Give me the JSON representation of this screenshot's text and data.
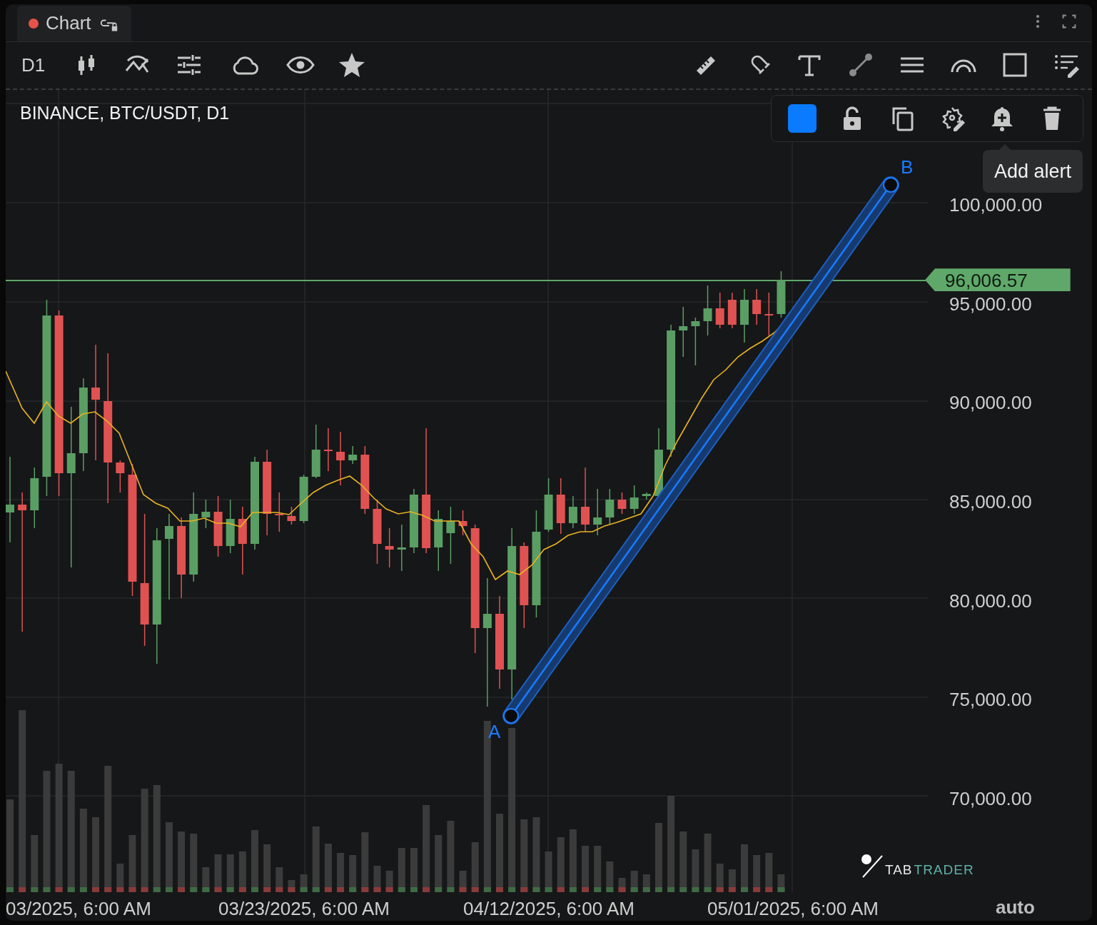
{
  "tabs": [
    {
      "label": "Chart",
      "selected": true
    }
  ],
  "toolbar": {
    "interval": "D1"
  },
  "chart": {
    "legend": "BINANCE, BTC/USDT, D1",
    "y_axis_labels": [
      "100,000.00",
      "95,000.00",
      "90,000.00",
      "85,000.00",
      "80,000.00",
      "75,000.00",
      "70,000.00"
    ],
    "last_price": "96,006.57",
    "trend_line": {
      "start_label": "A",
      "end_label": "B"
    },
    "tooltip": "Add alert",
    "logo": {
      "prefix": "TAB",
      "suffix": "TRADER"
    },
    "x_axis_labels": [
      "03/2025, 6:00 AM",
      "03/23/2025, 6:00 AM",
      "04/12/2025, 6:00 AM",
      "05/01/2025, 6:00 AM"
    ],
    "scale_mode": "auto"
  }
}
